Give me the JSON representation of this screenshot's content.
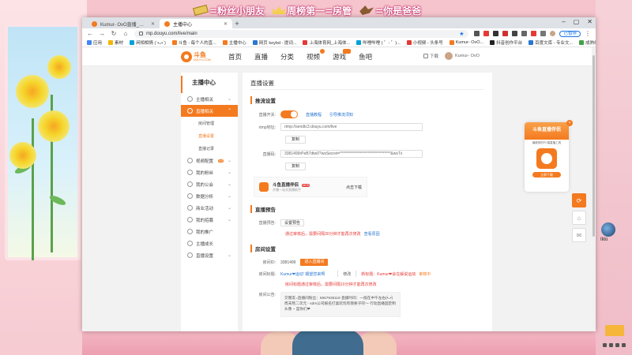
{
  "overlay": {
    "item1": "=粉丝小朋友",
    "item2": "周榜第一=房管",
    "item3": "=你是爸爸"
  },
  "desktop": {
    "icon_label": "Ilito"
  },
  "browser": {
    "tabs": [
      {
        "label": "Kumur- OvO直播_王者荣耀直播"
      },
      {
        "label": "主播中心"
      }
    ],
    "url": "mp.douyu.com/live/main",
    "paused_label": "已暂停",
    "bookmarks": [
      "应用",
      "素材",
      "闲相相情 (ˊ•ᴗ•ˋ)",
      "斗鱼 - 每个人的直...",
      "主播中心",
      "网页 keybd - 提词...",
      "上海体育网_上海体...",
      "哔哩哔哩 ( ゜- ゜)...",
      "小视频 - 头条号",
      "Kumur- OvO...",
      "抖音创作平台",
      "百度文库 - 专业文...",
      "成熟编辑, 站过的..."
    ]
  },
  "site": {
    "logo_text": "斗鱼",
    "logo_sub": "DOUYU.COM",
    "nav": [
      "首页",
      "直播",
      "分类",
      "视频",
      "游戏",
      "鱼吧"
    ],
    "download_label": "下载",
    "username": "Kumur- OvO"
  },
  "sidebar": {
    "title": "主播中心",
    "items": [
      {
        "label": "主播相关"
      },
      {
        "label": "直播相关"
      },
      {
        "label": "视频配置",
        "badge": "hot"
      },
      {
        "label": "我的粉丝"
      },
      {
        "label": "我的公会"
      },
      {
        "label": "数据分析"
      },
      {
        "label": "商业活动"
      },
      {
        "label": "我的招募"
      },
      {
        "label": "我的推广"
      },
      {
        "label": "主播成长"
      },
      {
        "label": "直播设置"
      }
    ],
    "subitems": [
      "房间管理",
      "直播设置",
      "直播记录"
    ]
  },
  "main": {
    "page_title": "直播设置",
    "push": {
      "title": "推流设置",
      "switch_label": "直播开关:",
      "help_link": "直播教程",
      "thirdparty_link": "引导推流须知",
      "rtmp_label": "rtmp地址:",
      "rtmp_value": "rtmp://sendtc3.douyu.com/live",
      "copy_label": "复制",
      "code_label": "直播码:",
      "code_value": "3381499rPeB7dtw0?wsSecret=*********************************&wsTx",
      "copy2_label": "复制"
    },
    "helper": {
      "title": "斗鱼直播伴侣",
      "new_badge": "NEW",
      "subtitle": "开播一站式直播助手",
      "download": "点击下载"
    },
    "preview": {
      "title": "直播预告",
      "label": "直播预告:",
      "set_btn": "设置预告",
      "notice": "通过审核后，需要间隔30分钟才能再次修改",
      "view_link": "查看原因"
    },
    "room": {
      "title": "房间设置",
      "id_label": "房间ID:",
      "id_value": "3381499",
      "enter_btn": "进入直播间",
      "name_label": "房间标题:",
      "name_value": "Kumur❤运动' 期望您来啊",
      "edit_link": "修改",
      "new_name_label": "新标题：",
      "new_name_value": "Kumur❤会在解说运动",
      "pending": "审核中",
      "name_notice": "房间标题通过审核后，需要间隔10分钟才能再次修改",
      "announce_label": "房间公告:",
      "announce_value": "交朋友=直播间粉丝：6967935119 直播时间：一般在中午左右(•̀ᴗ•́) 周末熬二次元 - sdm公司报名打喜欢玩有我要子的～ 行动直播固定制头像 ~ 是你们❤"
    }
  },
  "widget": {
    "title": "斗鱼直播伴侣",
    "subtitle": "最推荐的PC端直播工具",
    "button": "立即下载"
  }
}
